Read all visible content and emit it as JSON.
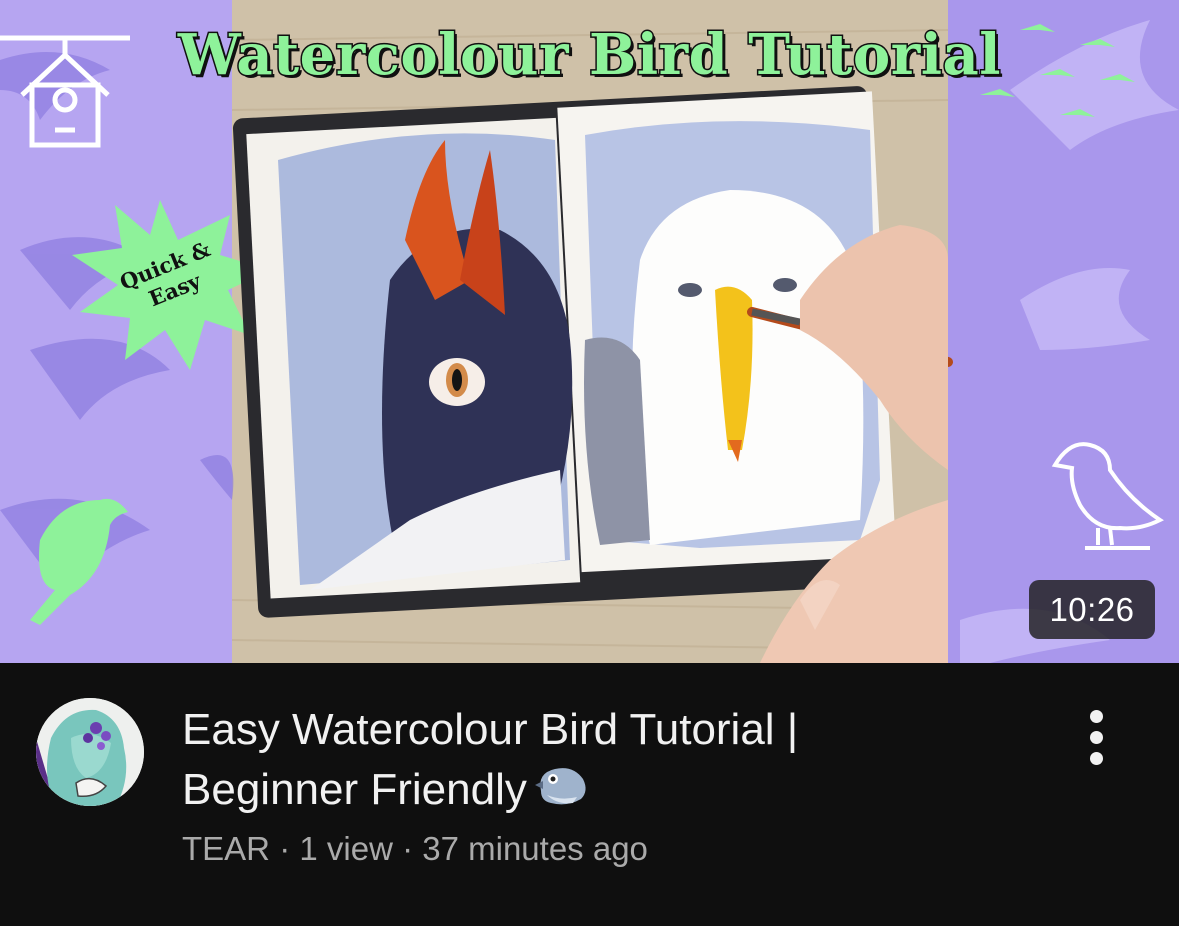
{
  "thumbnail": {
    "overlay_title": "Watercolour Bird Tutorial",
    "badge_line1": "Quick &",
    "badge_line2": "Easy",
    "duration": "10:26",
    "colors": {
      "side_purple": "#b6a5f1",
      "shape_purple": "#8f7fe0",
      "accent_green": "#8ef29a"
    }
  },
  "video": {
    "title_line1": "Easy Watercolour Bird Tutorial |",
    "title_line2": "Beginner Friendly",
    "title_emoji": "bird-emoji",
    "channel": "TEAR",
    "separator": "·",
    "views": "1 view",
    "age": "37 minutes ago"
  },
  "menu": {
    "icon": "more-vertical-icon"
  }
}
